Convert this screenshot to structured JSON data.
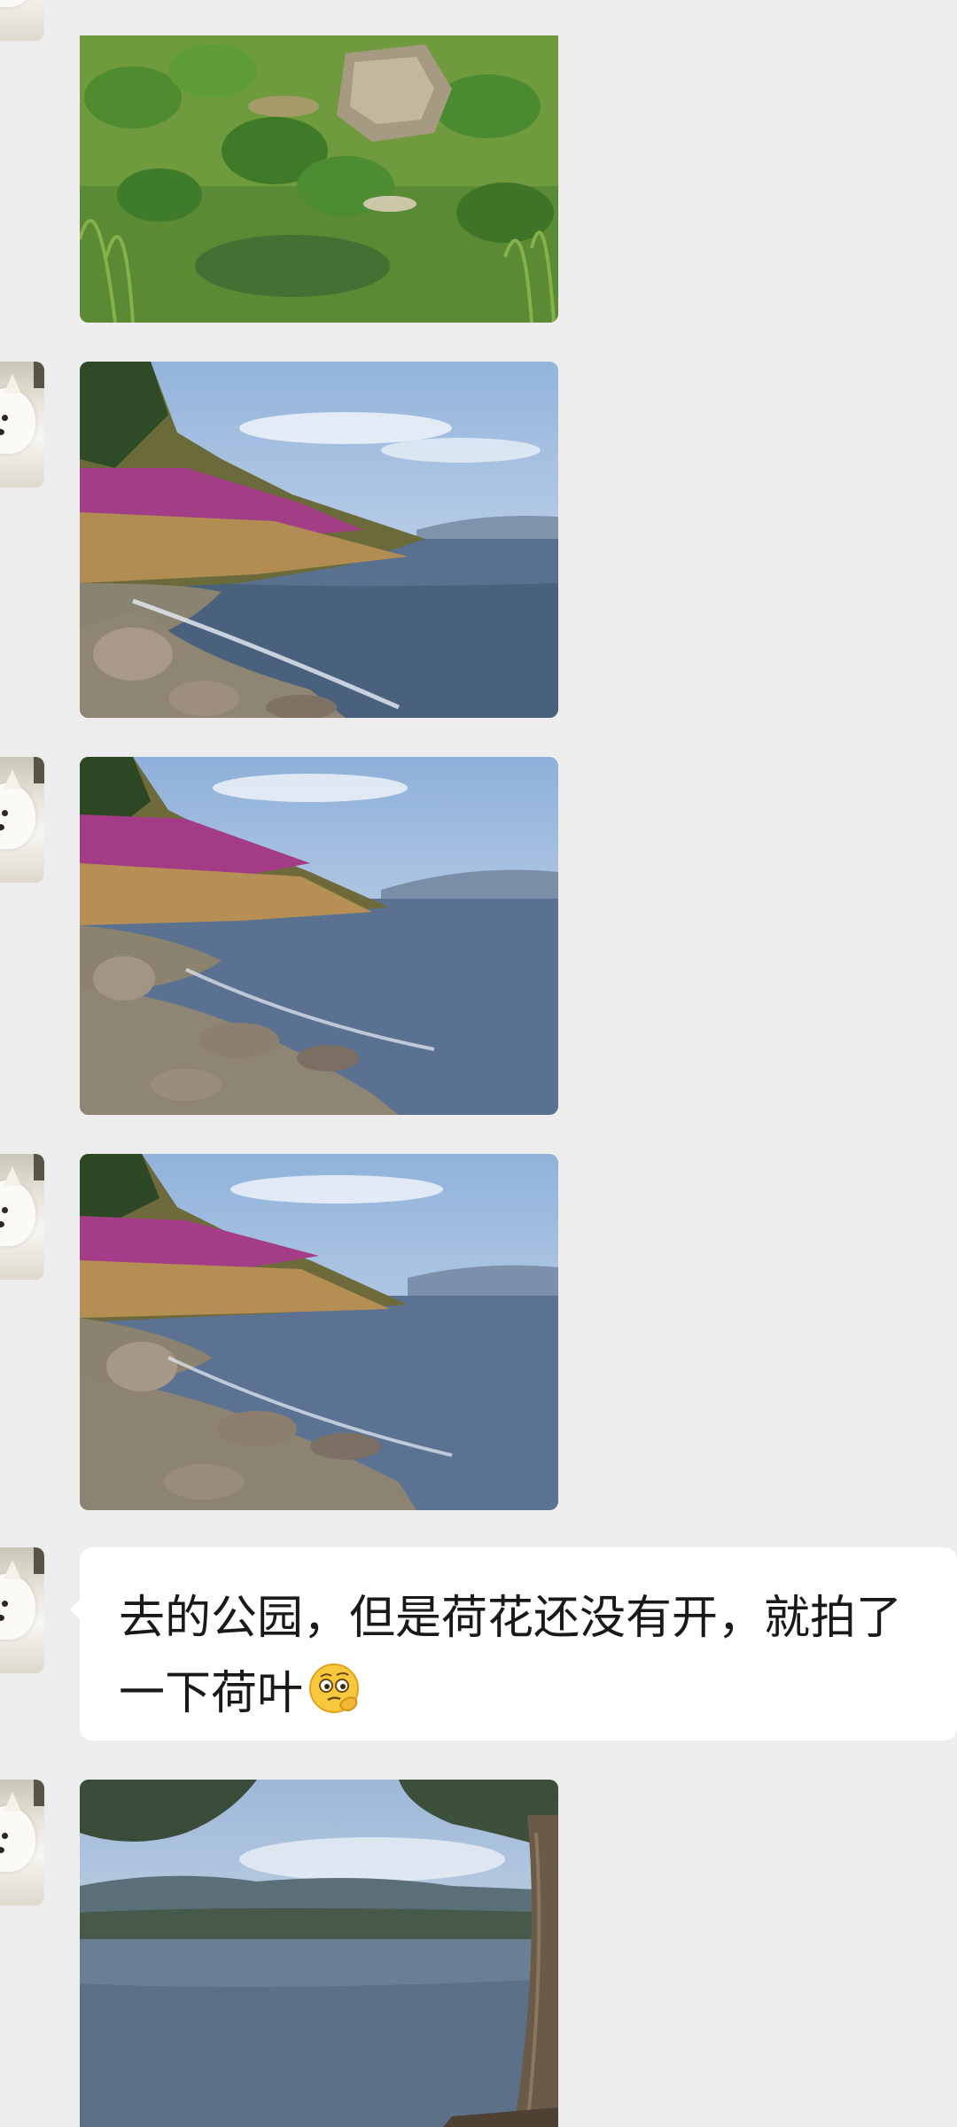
{
  "conversation": {
    "messages": [
      {
        "type": "image",
        "description_icon": "photo-lotus-pond"
      },
      {
        "type": "image",
        "description_icon": "photo-lakeshore"
      },
      {
        "type": "image",
        "description_icon": "photo-lakeshore"
      },
      {
        "type": "image",
        "description_icon": "photo-lakeshore"
      },
      {
        "type": "text",
        "text": "去的公园，但是荷花还没有开，就拍了一下荷叶",
        "emoji_icon": "thinking-face-emoji-icon"
      },
      {
        "type": "image",
        "description_icon": "photo-lake-with-trees"
      }
    ]
  },
  "colors": {
    "background": "#ededed",
    "bubble": "#ffffff",
    "text": "#191919"
  }
}
